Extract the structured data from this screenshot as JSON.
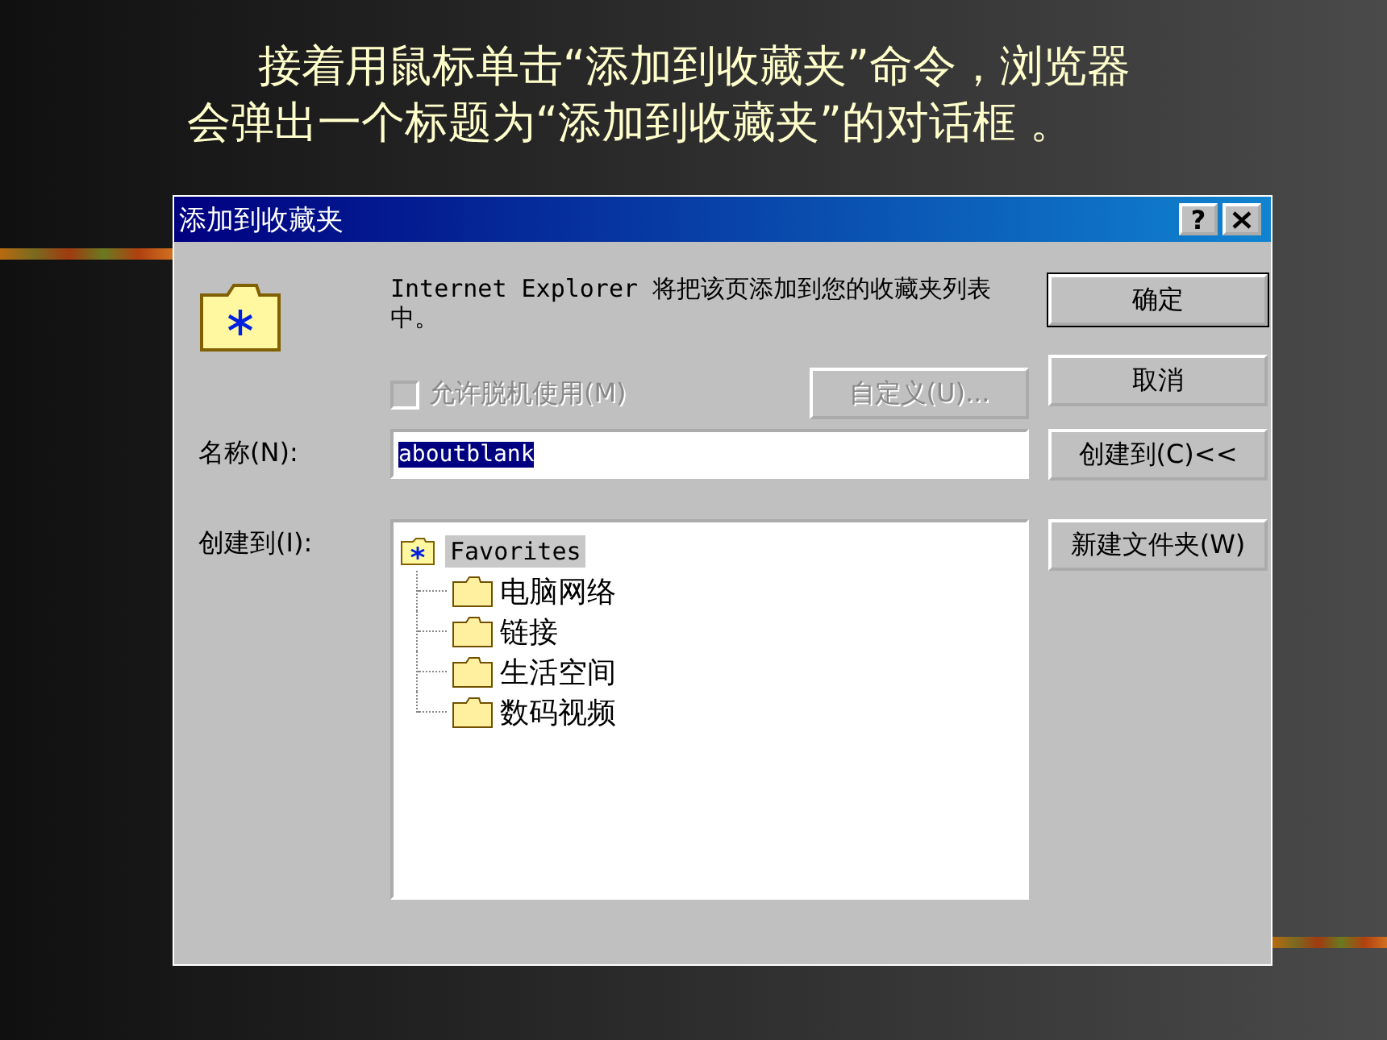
{
  "caption": {
    "lines": [
      "接着用鼠标单击“添加到收藏夹”命令，浏览器",
      "会弹出一个标题为“添加到收藏夹”的对话框 。"
    ]
  },
  "dialog": {
    "title": "添加到收藏夹",
    "help_button": "?",
    "description": "Internet Explorer 将把该页添加到您的收藏夹列表中。",
    "offline_checkbox": {
      "label": "允许脱机使用(M)",
      "checked": false,
      "disabled": true
    },
    "customize_button": {
      "label": "自定义(U)...",
      "disabled": true
    },
    "name_label": "名称(N):",
    "name_field": {
      "value": "aboutblank",
      "selected": true
    },
    "create_in_label": "创建到(I):",
    "tree": [
      {
        "label": "Favorites",
        "selected": true,
        "children": [
          {
            "label": "电脑网络",
            "selected": false
          },
          {
            "label": "链接",
            "selected": false
          },
          {
            "label": "生活空间",
            "selected": false
          },
          {
            "label": "数码视频",
            "selected": false
          }
        ]
      }
    ],
    "buttons": [
      {
        "label": "确定",
        "default": true
      },
      {
        "label": "取消",
        "default": false
      },
      {
        "label": "创建到(C)<<",
        "default": false
      },
      {
        "label": "新建文件夹(W)",
        "default": false
      }
    ]
  }
}
